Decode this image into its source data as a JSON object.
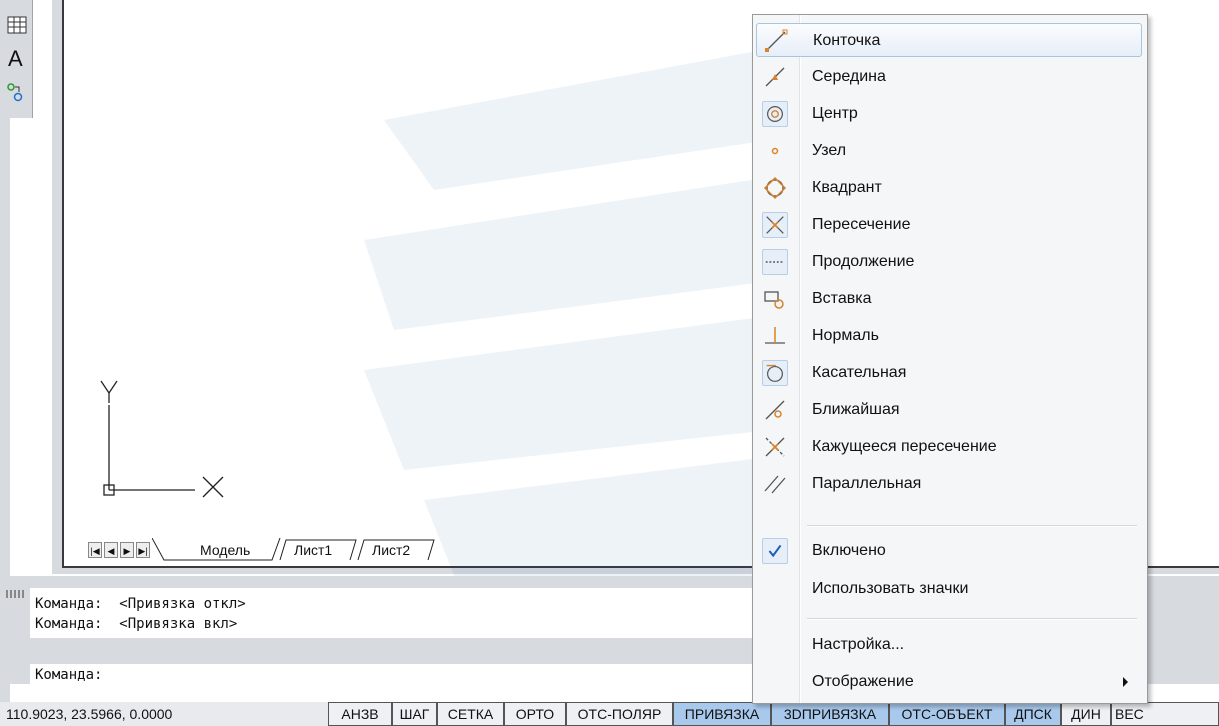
{
  "colors": {
    "panel_bg": "#d7dadf",
    "toggle_on": "#a9c9ec",
    "menu_bg": "#f5f6f7",
    "icon_orange": "#d9822b"
  },
  "toolbar": {
    "icons": [
      "table-icon",
      "text-icon",
      "attribute-icon"
    ]
  },
  "drawing": {
    "ucs_x_label": "X",
    "ucs_y_label": "Y"
  },
  "tabs": {
    "nav_first": "|◀",
    "nav_prev": "◀",
    "nav_next": "▶",
    "nav_last": "▶|",
    "items": [
      "Модель",
      "Лист1",
      "Лист2"
    ]
  },
  "command_line": {
    "history": [
      "Команда:  <Привязка откл>",
      "Команда:  <Привязка вкл>"
    ],
    "prompt": "Команда:"
  },
  "status_bar": {
    "coordinates": "110.9023, 23.5966, 0.0000",
    "toggles": [
      {
        "label": "АНЗВ",
        "on": false
      },
      {
        "label": "ШАГ",
        "on": false
      },
      {
        "label": "СЕТКА",
        "on": false
      },
      {
        "label": "ОРТО",
        "on": false
      },
      {
        "label": "ОТС-ПОЛЯР",
        "on": false
      },
      {
        "label": "ПРИВЯЗКА",
        "on": true
      },
      {
        "label": "3DПРИВЯЗКА",
        "on": true
      },
      {
        "label": "ОТС-ОБЪЕКТ",
        "on": true
      },
      {
        "label": "ДПСК",
        "on": true
      },
      {
        "label": "ДИН",
        "on": false
      },
      {
        "label": "ВЕС",
        "on": false
      }
    ]
  },
  "context_menu": {
    "snap_items": [
      {
        "label": "Конточка",
        "icon": "endpoint-icon"
      },
      {
        "label": "Середина",
        "icon": "midpoint-icon"
      },
      {
        "label": "Центр",
        "icon": "center-icon"
      },
      {
        "label": "Узел",
        "icon": "node-icon"
      },
      {
        "label": "Квадрант",
        "icon": "quadrant-icon"
      },
      {
        "label": "Пересечение",
        "icon": "intersection-icon"
      },
      {
        "label": "Продолжение",
        "icon": "extension-icon"
      },
      {
        "label": "Вставка",
        "icon": "insertion-icon"
      },
      {
        "label": "Нормаль",
        "icon": "perpendicular-icon"
      },
      {
        "label": "Касательная",
        "icon": "tangent-icon"
      },
      {
        "label": "Ближайшая",
        "icon": "nearest-icon"
      },
      {
        "label": "Кажущееся пересечение",
        "icon": "apparent-intersection-icon"
      },
      {
        "label": "Параллельная",
        "icon": "parallel-icon"
      }
    ],
    "enabled_label": "Включено",
    "enabled_checked": true,
    "use_icons_label": "Использовать значки",
    "settings_label": "Настройка...",
    "display_label": "Отображение"
  }
}
